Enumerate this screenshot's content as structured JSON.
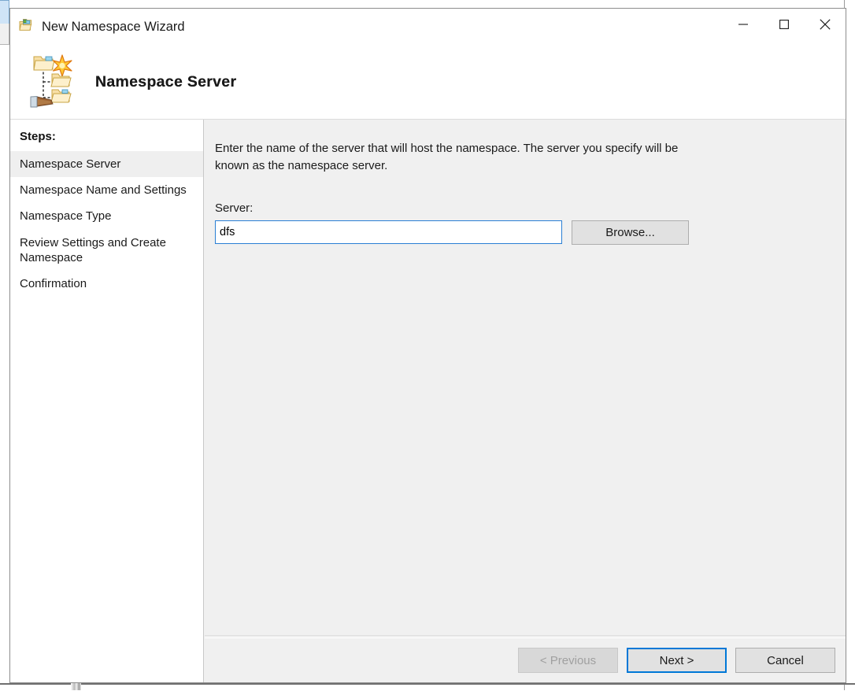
{
  "window": {
    "title": "New Namespace Wizard",
    "title_icon": "namespace-folder-icon",
    "controls": {
      "minimize": "minimize-icon",
      "maximize": "maximize-icon",
      "close": "close-icon"
    }
  },
  "banner": {
    "heading": "Namespace Server",
    "icon": "namespace-tree-hand-icon"
  },
  "sidebar": {
    "heading": "Steps:",
    "items": [
      {
        "label": "Namespace Server",
        "selected": true
      },
      {
        "label": "Namespace Name and Settings",
        "selected": false
      },
      {
        "label": "Namespace Type",
        "selected": false
      },
      {
        "label": "Review Settings and Create Namespace",
        "selected": false
      },
      {
        "label": "Confirmation",
        "selected": false
      }
    ]
  },
  "content": {
    "instruction": "Enter the name of the server that will host the namespace. The server you specify will be known as the namespace server.",
    "server_label": "Server:",
    "server_value": "dfs",
    "server_placeholder": "",
    "browse_label": "Browse..."
  },
  "footer": {
    "previous_label": "< Previous",
    "previous_enabled": false,
    "next_label": "Next >",
    "next_focused": true,
    "cancel_label": "Cancel"
  },
  "colors": {
    "accent": "#0078d7",
    "input_focus_border": "#2a7fd4",
    "dialog_bg": "#f0f0f0",
    "sidebar_bg": "#ffffff",
    "selected_step_bg": "#efefef",
    "button_bg": "#e1e1e1",
    "button_border": "#adadad",
    "disabled_text": "#a0a0a0",
    "text": "#1a1a1a"
  }
}
